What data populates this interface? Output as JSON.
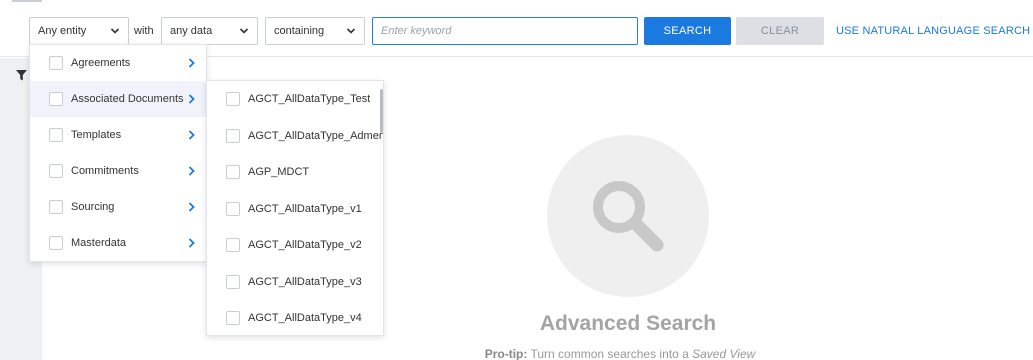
{
  "search": {
    "entity_value": "Any entity",
    "with_label": "with",
    "data_value": "any data",
    "condition_value": "containing",
    "keyword_placeholder": "Enter keyword",
    "search_label": "SEARCH",
    "clear_label": "CLEAR",
    "nl_search_label": "USE NATURAL LANGUAGE SEARCH"
  },
  "entity_menu": {
    "items": [
      {
        "label": "Agreements"
      },
      {
        "label": "Associated Documents"
      },
      {
        "label": "Templates"
      },
      {
        "label": "Commitments"
      },
      {
        "label": "Sourcing"
      },
      {
        "label": "Masterdata"
      }
    ]
  },
  "submenu": {
    "items": [
      {
        "label": "AGCT_AllDataType_Test"
      },
      {
        "label": "AGCT_AllDataType_Admen"
      },
      {
        "label": "AGP_MDCT"
      },
      {
        "label": "AGCT_AllDataType_v1"
      },
      {
        "label": "AGCT_AllDataType_v2"
      },
      {
        "label": "AGCT_AllDataType_v3"
      },
      {
        "label": "AGCT_AllDataType_v4"
      }
    ]
  },
  "empty_state": {
    "title": "Advanced Search",
    "protip_label": "Pro-tip:",
    "protip_text": "Turn common searches into a",
    "protip_link": "Saved View"
  },
  "colors": {
    "accent": "#1b7ae0",
    "clear_bg": "#dcdfe3",
    "illustration_bg": "#efefef"
  },
  "icons": {
    "chevron": "chevron-down-icon",
    "arrow": "chevron-right-icon",
    "filter": "filter-icon",
    "search": "magnifier-icon"
  }
}
